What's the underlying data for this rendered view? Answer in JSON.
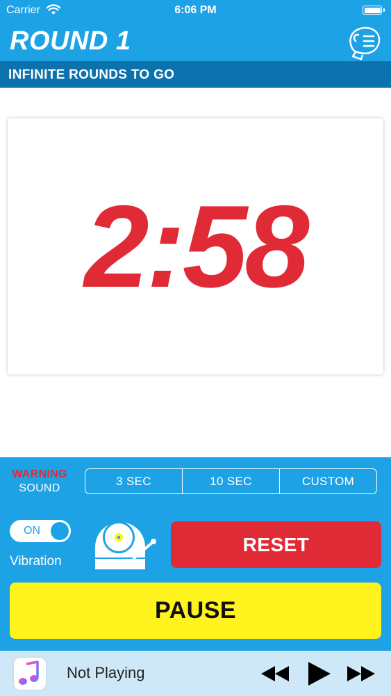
{
  "status_bar": {
    "carrier": "Carrier",
    "time": "6:06 PM"
  },
  "header": {
    "title": "ROUND 1",
    "subtitle": "INFINITE ROUNDS TO GO",
    "menu_icon": "glove-menu-icon"
  },
  "timer": {
    "display": "2:58"
  },
  "warning": {
    "label_top": "WARNING",
    "label_bottom": "SOUND",
    "options": [
      "3 SEC",
      "10 SEC",
      "CUSTOM"
    ]
  },
  "vibration": {
    "toggle_text": "ON",
    "label": "Vibration",
    "enabled": true
  },
  "buttons": {
    "reset": "RESET",
    "pause": "PAUSE"
  },
  "player": {
    "status": "Not Playing"
  },
  "colors": {
    "primary_blue": "#1ea2e6",
    "dark_blue": "#0c72ae",
    "red": "#e02b36",
    "yellow": "#fff31d"
  }
}
